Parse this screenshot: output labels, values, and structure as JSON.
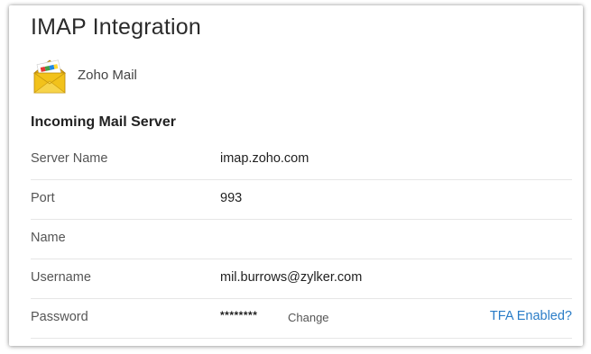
{
  "page": {
    "title": "IMAP Integration"
  },
  "provider": {
    "name": "Zoho Mail",
    "icon": "zoho-mail-envelope-icon"
  },
  "incoming": {
    "section_title": "Incoming Mail Server",
    "fields": {
      "server_name": {
        "label": "Server Name",
        "value": "imap.zoho.com"
      },
      "port": {
        "label": "Port",
        "value": "993"
      },
      "name": {
        "label": "Name",
        "value": ""
      },
      "username": {
        "label": "Username",
        "value": "mil.burrows@zylker.com"
      },
      "password": {
        "label": "Password",
        "value": "********",
        "change_label": "Change",
        "tfa_label": "TFA Enabled?"
      }
    }
  },
  "colors": {
    "link": "#2a7cc7",
    "envelope": "#f2c21b"
  }
}
